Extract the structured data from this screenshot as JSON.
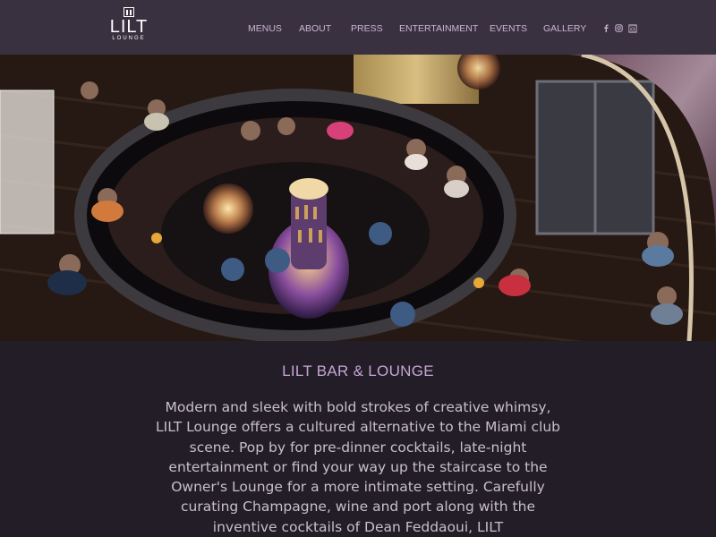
{
  "brand": {
    "name": "LILT",
    "tagline": "LOUNGE"
  },
  "nav": {
    "items": [
      {
        "label": "MENUS"
      },
      {
        "label": "ABOUT"
      },
      {
        "label": "PRESS"
      },
      {
        "label": "ENTERTAINMENT"
      },
      {
        "label": "EVENTS"
      },
      {
        "label": "GALLERY"
      }
    ]
  },
  "social": {
    "icons": [
      "facebook-icon",
      "instagram-icon",
      "tripadvisor-icon"
    ]
  },
  "hero": {
    "image_subject": "overhead view of a crowded round bar with a glowing bottle tower"
  },
  "section": {
    "title": "LILT BAR & LOUNGE",
    "body": "Modern and sleek with bold strokes of creative whimsy, LILT Lounge offers a cultured alternative to the Miami club scene. Pop by for pre-dinner cocktails, late-night entertainment or find your way up the staircase to the Owner's Lounge for a more intimate setting. Carefully curating Champagne, wine and port along with the inventive cocktails of Dean Feddaoui, LILT"
  },
  "colors": {
    "header_bg": "#3a3140",
    "page_bg": "#221d26",
    "accent": "#c6a5d6",
    "nav_text": "#c9b3d3",
    "body_text": "#c8c0c8"
  }
}
